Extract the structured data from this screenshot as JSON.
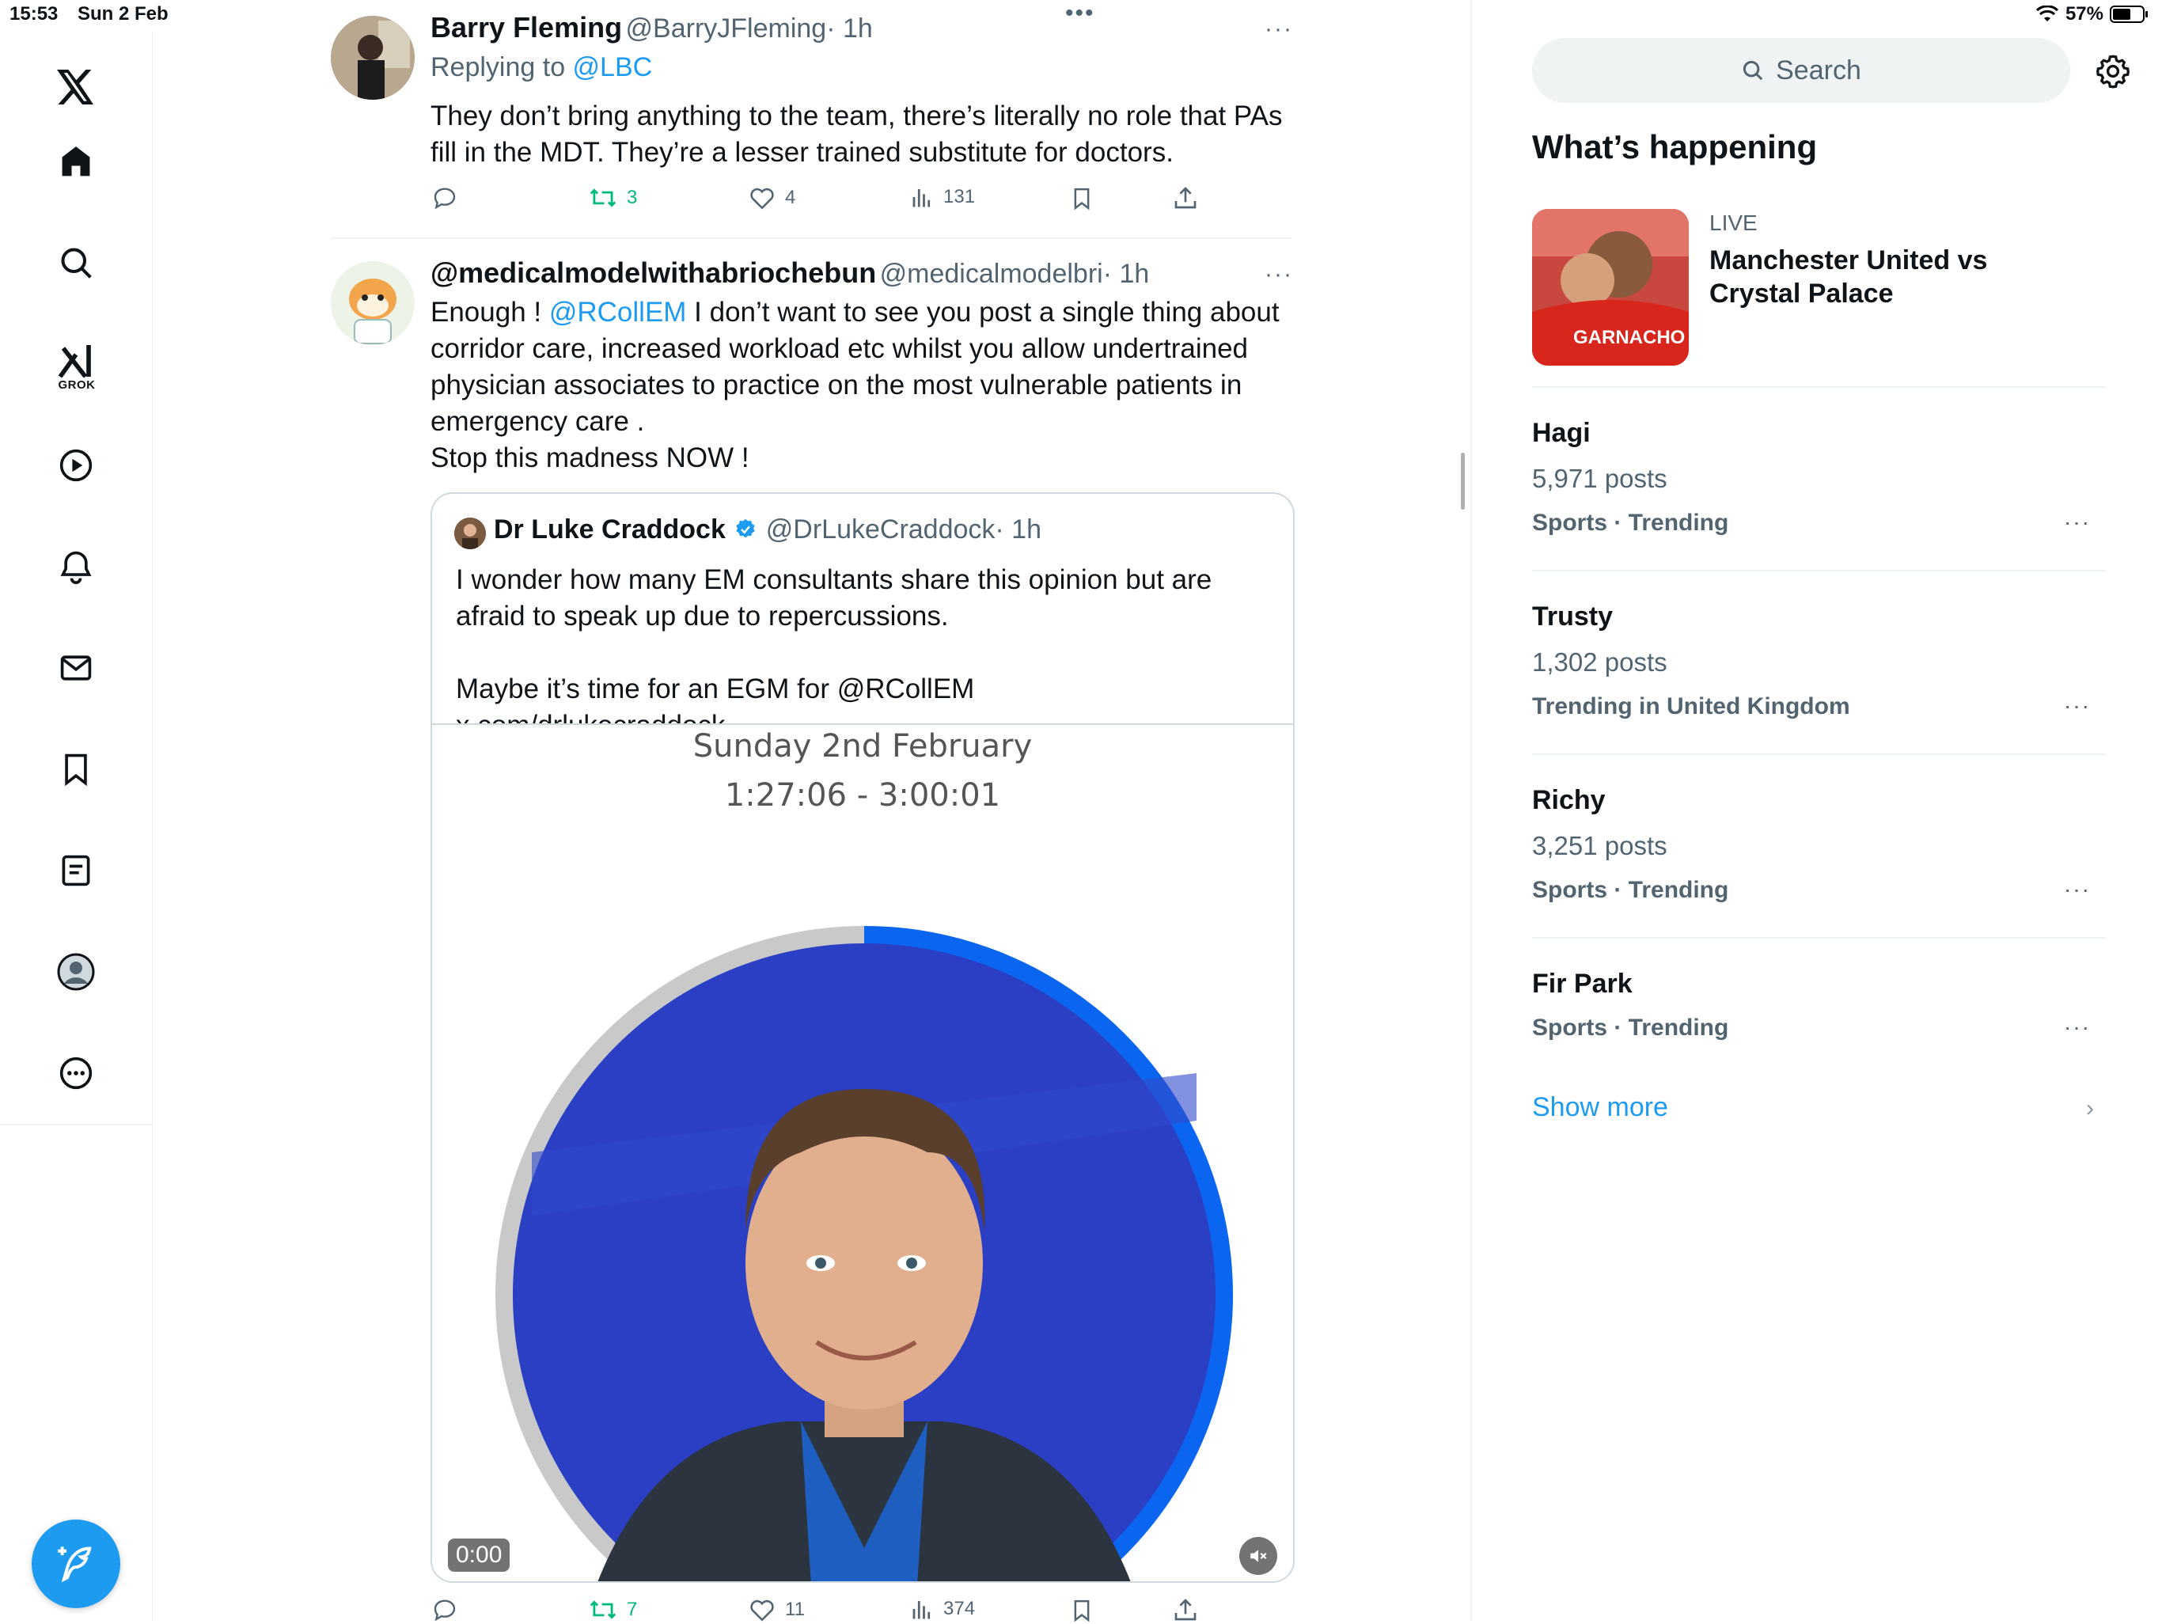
{
  "status_bar": {
    "time": "15:53",
    "date": "Sun 2 Feb",
    "battery": "57%"
  },
  "left_nav": {
    "grok_label": "GROK"
  },
  "tweets": [
    {
      "name": "Barry Fleming",
      "handle": "@BarryJFleming",
      "time": "· 1h",
      "replying_prefix": "Replying to ",
      "replying_to": "@LBC",
      "text": "They don’t bring anything to the team, there’s literally no role that PAs fill in the MDT. They’re a lesser trained substitute for doctors.",
      "retweets": "3",
      "likes": "4",
      "views": "131"
    },
    {
      "name": "@medicalmodelwithabriochebun",
      "handle": "@medicalmodelbri",
      "time": "· 1h",
      "text_prefix": "Enough ! ",
      "text_mention": "@RCollEM",
      "text_rest": " I don’t want to see you post a single thing about corridor care, increased workload etc whilst you allow undertrained physician associates to practice on the most vulnerable patients in emergency care .",
      "text_line2": "Stop this madness NOW !",
      "retweets": "7",
      "likes": "11",
      "views": "374"
    }
  ],
  "quote": {
    "name": "Dr Luke Craddock",
    "handle": "@DrLukeCraddock",
    "time": "· 1h",
    "text1": "I wonder how many EM consultants share this opinion but are afraid to speak up due to repercussions.",
    "text2": "Maybe it’s time for an EGM for @RCollEM x.com/drlukecraddock...",
    "video_date": "Sunday 2nd February",
    "video_time": "1:27:06 - 3:00:01",
    "timer": "0:00",
    "ring_progress": 0.38
  },
  "sidebar": {
    "search_placeholder": "Search",
    "title": "What’s happening",
    "live": {
      "label": "LIVE",
      "title": "Manchester United vs Crystal Palace",
      "shirt_text": "GARNACHO"
    },
    "trends": [
      {
        "name": "Hagi",
        "count": "5,971 posts",
        "category": "Sports · Trending"
      },
      {
        "name": "Trusty",
        "count": "1,302 posts",
        "category": "Trending in United Kingdom"
      },
      {
        "name": "Richy",
        "count": "3,251 posts",
        "category": "Sports · Trending"
      },
      {
        "name": "Fir Park",
        "count": "",
        "category": "Sports · Trending"
      }
    ],
    "show_more": "Show more"
  },
  "colors": {
    "accent": "#1d9bf0",
    "retweet": "#00ba7c",
    "ring": "#0a66f0"
  }
}
